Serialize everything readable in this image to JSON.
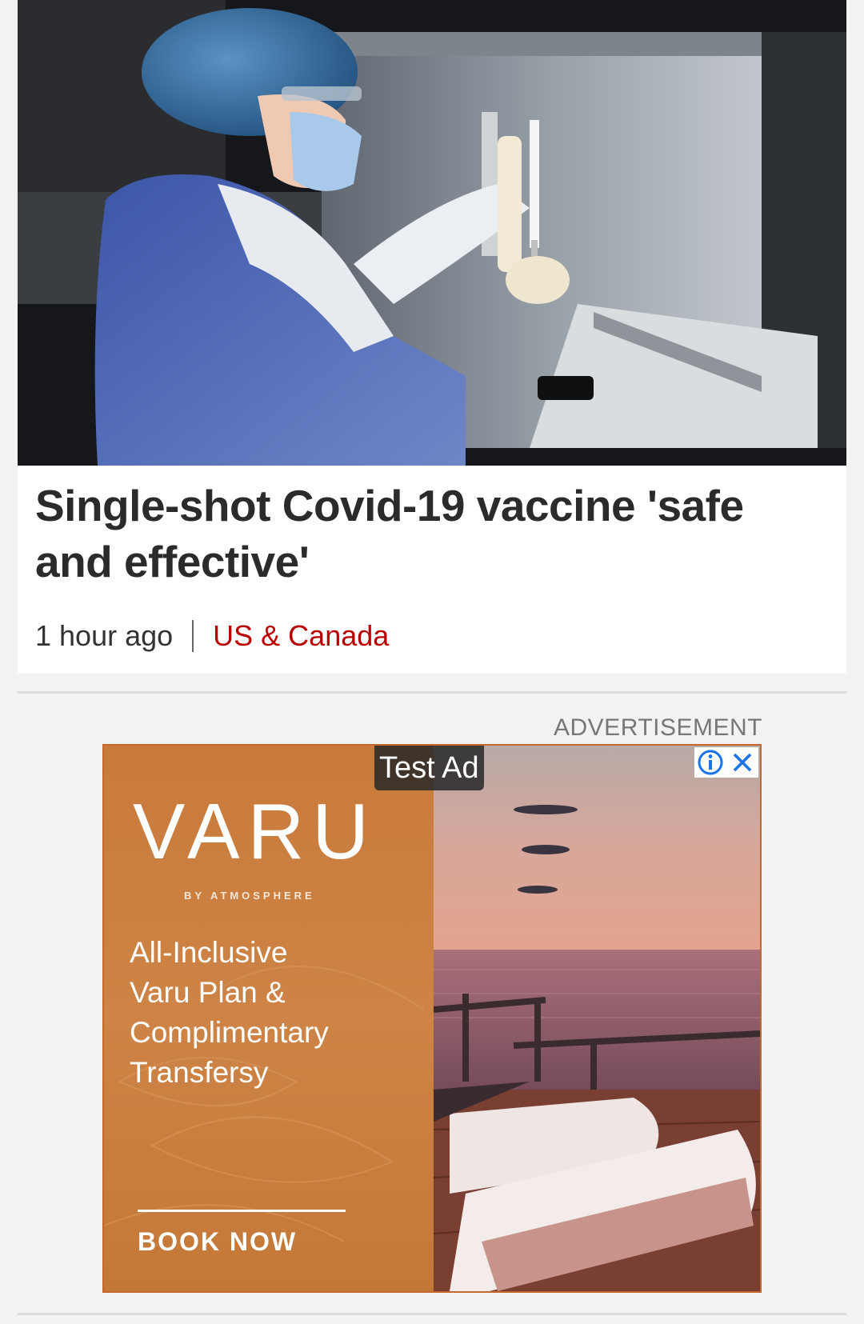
{
  "article": {
    "headline": "Single-shot Covid-19 vaccine 'safe and effective'",
    "time": "1 hour ago",
    "section": "US & Canada",
    "image_icon": "lab-technician-vaccine-photo"
  },
  "advertisement": {
    "label": "ADVERTISEMENT",
    "test_badge": "Test Ad",
    "info_icon": "info-icon",
    "close_icon": "close-icon",
    "brand": "VARU",
    "brand_sub": "BY ATMOSPHERE",
    "copy": "All-Inclusive\nVaru Plan &\nComplimentary\nTransfersy",
    "cta": "BOOK NOW",
    "colors": {
      "panel": "#c87a3a",
      "border": "#c4692a",
      "info": "#1a73e8"
    }
  },
  "colors": {
    "section_link": "#b80000",
    "headline": "#2b2b2b",
    "background": "#f2f2f2"
  }
}
